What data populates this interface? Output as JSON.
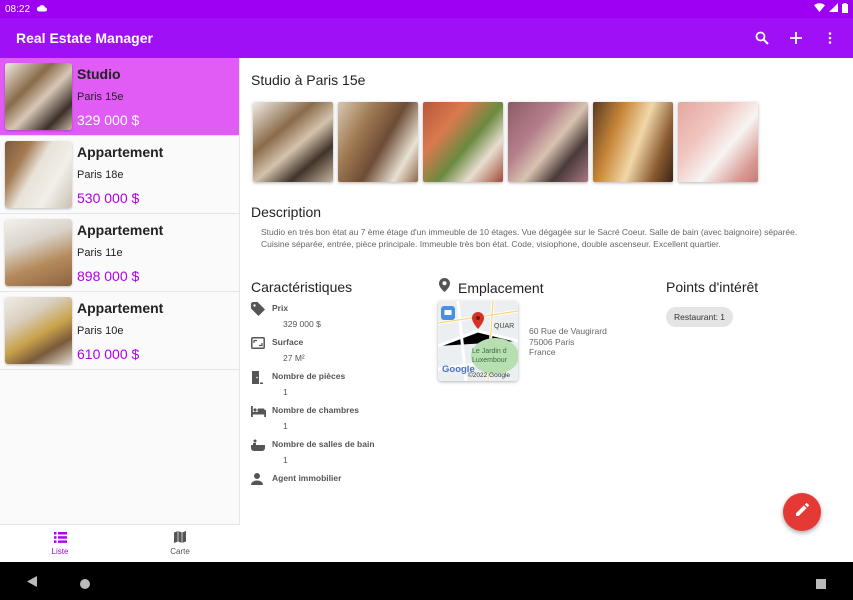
{
  "status_bar": {
    "time": "08:22"
  },
  "app_bar": {
    "title": "Real Estate Manager",
    "icons": [
      "search-icon",
      "add-icon",
      "more-vert-icon"
    ]
  },
  "list": [
    {
      "type": "Studio",
      "city": "Paris 15e",
      "price": "329 000 $",
      "selected": true
    },
    {
      "type": "Appartement",
      "city": "Paris 18e",
      "price": "530 000 $",
      "selected": false
    },
    {
      "type": "Appartement",
      "city": "Paris 11e",
      "price": "898 000 $",
      "selected": false
    },
    {
      "type": "Appartement",
      "city": "Paris 10e",
      "price": "610 000 $",
      "selected": false
    }
  ],
  "bottom_nav": {
    "list_label": "Liste",
    "map_label": "Carte"
  },
  "detail": {
    "title": "Studio à Paris 15e",
    "description_title": "Description",
    "description": "Studio en très bon état au 7 ème étage d'un immeuble de 10 étages. Vue dégagée sur le Sacré Coeur. Salle de bain (avec baignoire) séparée. Cuisine séparée, entrée, pièce principale. Immeuble très bon état. Code, visiophone, double ascenseur. Excellent quartier.",
    "characteristics_title": "Caractéristiques",
    "characteristics": [
      {
        "label": "Prix",
        "value": "329 000 $",
        "icon": "tag-icon"
      },
      {
        "label": "Surface",
        "value": "27 M²",
        "icon": "surface-icon"
      },
      {
        "label": "Nombre de pièces",
        "value": "1",
        "icon": "door-icon"
      },
      {
        "label": "Nombre de chambres",
        "value": "1",
        "icon": "bed-icon"
      },
      {
        "label": "Nombre de salles de bain",
        "value": "1",
        "icon": "bathtub-icon"
      },
      {
        "label": "Agent immobilier",
        "value": "",
        "icon": "person-icon"
      }
    ],
    "location_title": "Emplacement",
    "map": {
      "quarter": "QUAR",
      "park_line1": "Le Jardin d",
      "park_line2": "Luxembour",
      "google": "Google",
      "copyright": "©2022 Google"
    },
    "address": {
      "line1": "60 Rue de Vaugirard",
      "line2": "75006 Paris",
      "line3": "France"
    },
    "poi_title": "Points d'intérêt",
    "poi_chip": "Restaurant: 1"
  },
  "colors": {
    "primary": "#a010f6",
    "selected_item": "#e05cf5",
    "price": "#b000e8",
    "fab": "#e53935"
  }
}
